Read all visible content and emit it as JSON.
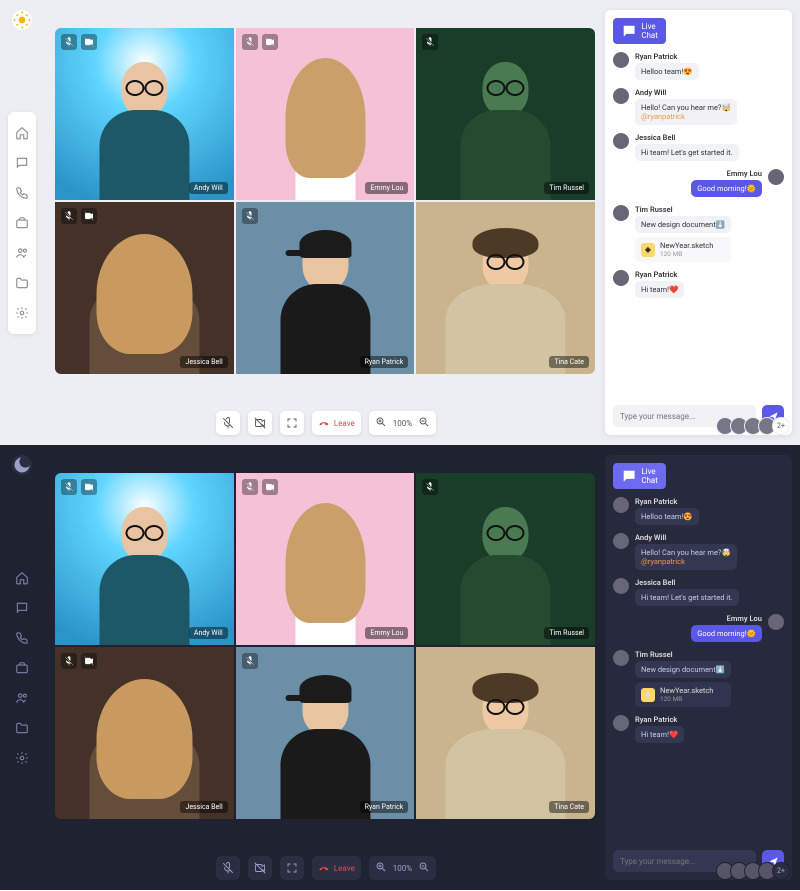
{
  "themes": [
    "light",
    "dark"
  ],
  "sidebar": {
    "items": [
      {
        "name": "home",
        "icon": "home"
      },
      {
        "name": "chat",
        "icon": "message"
      },
      {
        "name": "calls",
        "icon": "phone"
      },
      {
        "name": "contacts",
        "icon": "briefcase"
      },
      {
        "name": "team",
        "icon": "users"
      },
      {
        "name": "files",
        "icon": "folder"
      },
      {
        "name": "settings",
        "icon": "gear"
      }
    ]
  },
  "participants": [
    {
      "name": "Andy Will",
      "mic_muted": true,
      "cam_off": true,
      "bg": "p1",
      "glasses": true
    },
    {
      "name": "Emmy Lou",
      "mic_muted": true,
      "cam_off": true,
      "bg": "p2",
      "hair": true
    },
    {
      "name": "Tim Russel",
      "mic_muted": true,
      "cam_off": false,
      "bg": "p3",
      "glasses": true
    },
    {
      "name": "Jessica Bell",
      "mic_muted": true,
      "cam_off": true,
      "bg": "p4",
      "hair": true
    },
    {
      "name": "Ryan Patrick",
      "mic_muted": true,
      "cam_off": false,
      "bg": "p5",
      "cap": true
    },
    {
      "name": "Tina Cate",
      "mic_muted": false,
      "cam_off": false,
      "bg": "p6",
      "glasses": true,
      "hair": true
    }
  ],
  "controls": {
    "leave_label": "Leave",
    "zoom_label": "100%"
  },
  "chat": {
    "header": "Live Chat",
    "input_placeholder": "Type your message...",
    "messages": [
      {
        "sender": "Ryan Patrick",
        "me": false,
        "body": "Helloo team!😍"
      },
      {
        "sender": "Andy Will",
        "me": false,
        "body": "Hello! Can you hear me?🤯 ",
        "mention": "@ryanpatrick"
      },
      {
        "sender": "Jessica Bell",
        "me": false,
        "body": "Hi team! Let's get started it."
      },
      {
        "sender": "Emmy Lou",
        "me": true,
        "body": "Good morning!🌞"
      },
      {
        "sender": "Tim Russel",
        "me": false,
        "body": "New design document⬇️",
        "attachment": {
          "name": "NewYear.sketch",
          "size": "120 MB"
        }
      },
      {
        "sender": "Ryan Patrick",
        "me": false,
        "body": "Hi team!❤️"
      }
    ]
  },
  "avatar_stack": {
    "visible": 4,
    "more": "2+"
  }
}
